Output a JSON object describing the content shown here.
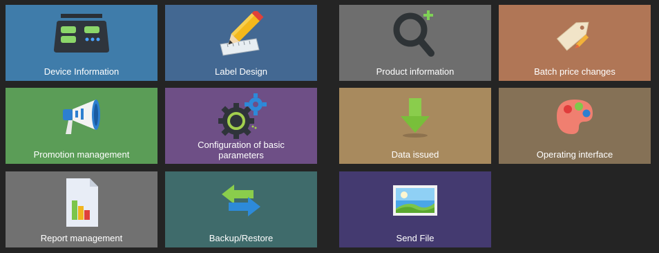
{
  "tiles": [
    {
      "label": "Device Information",
      "icon": "device-icon",
      "color": "#3f7caa"
    },
    {
      "label": "Label Design",
      "icon": "pencil-ruler-icon",
      "color": "#436892"
    },
    {
      "label": "Product information",
      "icon": "search-add-icon",
      "color": "#6e6e6e"
    },
    {
      "label": "Batch price changes",
      "icon": "price-tag-icon",
      "color": "#b07656"
    },
    {
      "label": "Promotion management",
      "icon": "megaphone-icon",
      "color": "#5b9d57"
    },
    {
      "label": "Configuration of basic parameters",
      "icon": "gears-icon",
      "color": "#6e4f86"
    },
    {
      "label": "Data issued",
      "icon": "download-arrow-icon",
      "color": "#a88a5e"
    },
    {
      "label": "Operating interface",
      "icon": "palette-icon",
      "color": "#857156"
    },
    {
      "label": "Report management",
      "icon": "report-chart-icon",
      "color": "#717171"
    },
    {
      "label": "Backup/Restore",
      "icon": "sync-arrows-icon",
      "color": "#3f6b6b"
    },
    {
      "label": "Send File",
      "icon": "image-file-icon",
      "color": "#443a70"
    }
  ]
}
